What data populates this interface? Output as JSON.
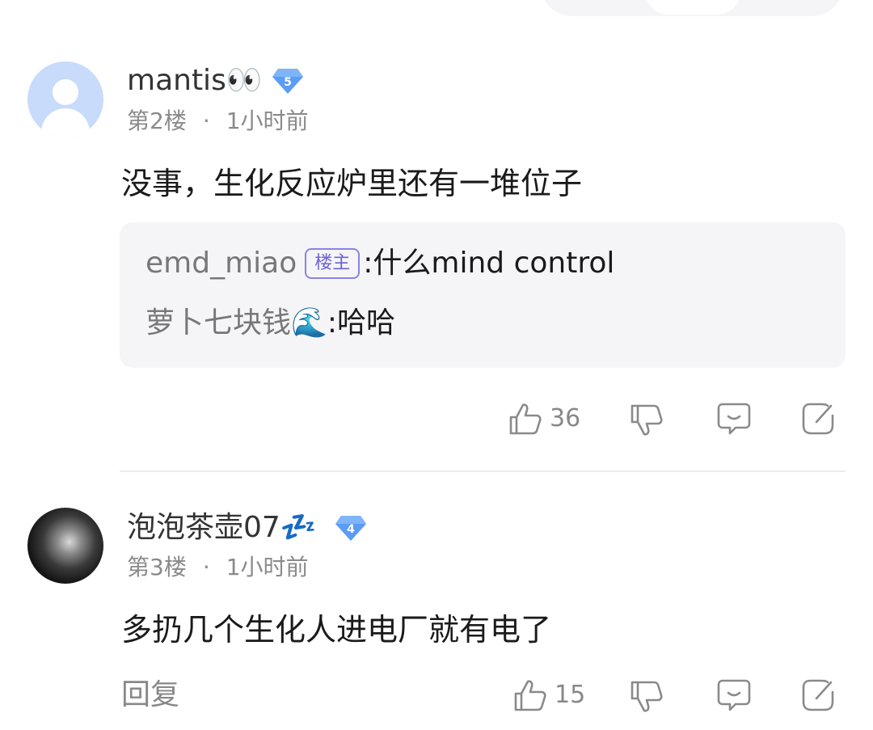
{
  "comments": [
    {
      "username": "mantis👀",
      "level": "5",
      "floor": "第2楼",
      "time": "1小时前",
      "content": "没事，生化反应炉里还有一堆位子",
      "replies": [
        {
          "user": "emd_miao",
          "tag": "楼主",
          "sep": ": ",
          "text": "什么mind control"
        },
        {
          "user": "萝卜七块钱🌊",
          "sep": ": ",
          "text": "哈哈"
        }
      ],
      "likes": "36"
    },
    {
      "username": "泡泡茶壶07💤",
      "level": "4",
      "floor": "第3楼",
      "time": "1小时前",
      "content": "多扔几个生化人进电厂就有电了",
      "reply_label": "回复",
      "likes": "15"
    }
  ],
  "meta_separator": "·",
  "colors": {
    "level_badge": "#5b9cf5",
    "op_tag": "#6b63d8",
    "reply_box": "#f5f5f7"
  }
}
